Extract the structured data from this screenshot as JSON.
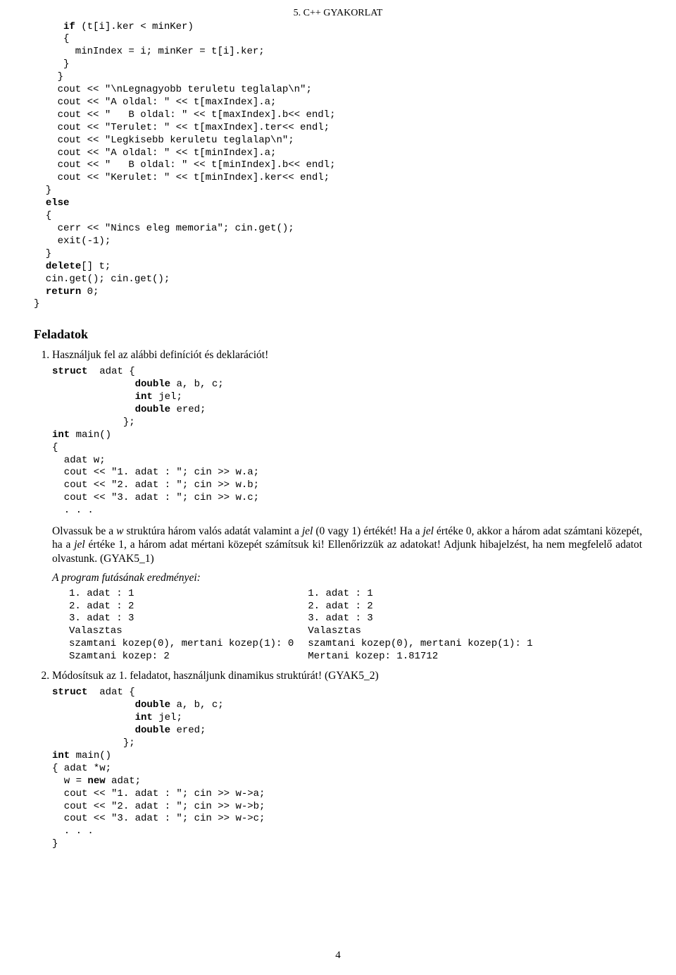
{
  "header": {
    "title": "5. C++ GYAKORLAT"
  },
  "code_top": "     if (t[i].ker < minKer)\n     {\n       minIndex = i; minKer = t[i].ker;\n     }\n    }\n    cout << \"\\nLegnagyobb teruletu teglalap\\n\";\n    cout << \"A oldal: \" << t[maxIndex].a;\n    cout << \"   B oldal: \" << t[maxIndex].b<< endl;\n    cout << \"Terulet: \" << t[maxIndex].ter<< endl;\n    cout << \"Legkisebb keruletu teglalap\\n\";\n    cout << \"A oldal: \" << t[minIndex].a;\n    cout << \"   B oldal: \" << t[minIndex].b<< endl;\n    cout << \"Kerulet: \" << t[minIndex].ker<< endl;\n  }\n  else\n  {\n    cerr << \"Nincs eleg memoria\"; cin.get();\n    exit(-1);\n  }\n  delete[] t;\n  cin.get(); cin.get();\n  return 0;\n}",
  "section_heading": "Feladatok",
  "tasks": [
    {
      "intro": "Használjuk fel az alábbi definíciót és deklarációt!",
      "code": "struct  adat {\n              double a, b, c;\n              int jel;\n              double ered;\n            };\nint main()\n{\n  adat w;\n  cout << \"1. adat : \"; cin >> w.a;\n  cout << \"2. adat : \"; cin >> w.b;\n  cout << \"3. adat : \"; cin >> w.c;\n  . . .",
      "paragraph_parts": {
        "p1": "Olvassuk be a ",
        "w1": "w",
        "p2": " struktúra három valós adatát valamint a ",
        "jel1": "jel",
        "p3": " (0 vagy 1) értékét! Ha a ",
        "jel2": "jel",
        "p4": " értéke 0, akkor a három adat számtani közepét, ha a ",
        "jel3": "jel",
        "p5": " értéke 1, a három adat mértani közepét számítsuk ki! Ellenőrizzük az adatokat! Adjunk hiba­jelzést, ha nem megfelelő adatot olvastunk. (GYAK5_1)"
      },
      "run_caption": "A program futásának eredményei:",
      "run_left": "1. adat : 1\n2. adat : 2\n3. adat : 3\nValasztas\nszamtani kozep(0), mertani kozep(1): 0\nSzamtani kozep: 2",
      "run_right": "1. adat : 1\n2. adat : 2\n3. adat : 3\nValasztas\nszamtani kozep(0), mertani kozep(1): 1\nMertani kozep: 1.81712"
    },
    {
      "intro": "Módosítsuk az 1. feladatot, használjunk dinamikus struktúrát! (GYAK5_2)",
      "code": "struct  adat {\n              double a, b, c;\n              int jel;\n              double ered;\n            };\nint main()\n{ adat *w;\n  w = new adat;\n  cout << \"1. adat : \"; cin >> w->a;\n  cout << \"2. adat : \"; cin >> w->b;\n  cout << \"3. adat : \"; cin >> w->c;\n  . . .\n}"
    }
  ],
  "page_number": "4"
}
